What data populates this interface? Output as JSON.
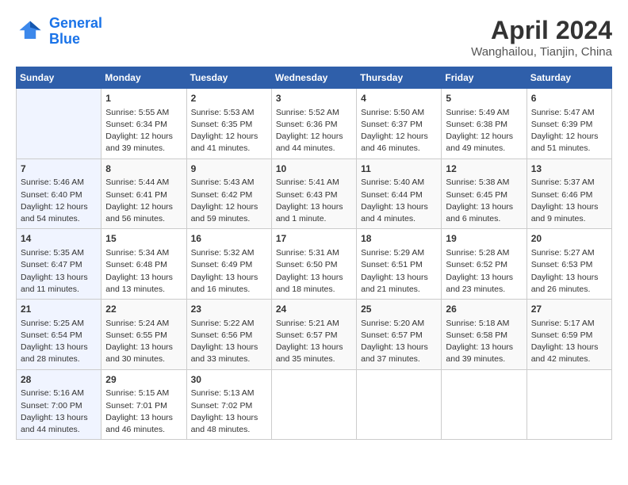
{
  "header": {
    "logo_line1": "General",
    "logo_line2": "Blue",
    "month": "April 2024",
    "location": "Wanghailou, Tianjin, China"
  },
  "days_of_week": [
    "Sunday",
    "Monday",
    "Tuesday",
    "Wednesday",
    "Thursday",
    "Friday",
    "Saturday"
  ],
  "weeks": [
    [
      {
        "num": "",
        "info": ""
      },
      {
        "num": "1",
        "info": "Sunrise: 5:55 AM\nSunset: 6:34 PM\nDaylight: 12 hours\nand 39 minutes."
      },
      {
        "num": "2",
        "info": "Sunrise: 5:53 AM\nSunset: 6:35 PM\nDaylight: 12 hours\nand 41 minutes."
      },
      {
        "num": "3",
        "info": "Sunrise: 5:52 AM\nSunset: 6:36 PM\nDaylight: 12 hours\nand 44 minutes."
      },
      {
        "num": "4",
        "info": "Sunrise: 5:50 AM\nSunset: 6:37 PM\nDaylight: 12 hours\nand 46 minutes."
      },
      {
        "num": "5",
        "info": "Sunrise: 5:49 AM\nSunset: 6:38 PM\nDaylight: 12 hours\nand 49 minutes."
      },
      {
        "num": "6",
        "info": "Sunrise: 5:47 AM\nSunset: 6:39 PM\nDaylight: 12 hours\nand 51 minutes."
      }
    ],
    [
      {
        "num": "7",
        "info": "Sunrise: 5:46 AM\nSunset: 6:40 PM\nDaylight: 12 hours\nand 54 minutes."
      },
      {
        "num": "8",
        "info": "Sunrise: 5:44 AM\nSunset: 6:41 PM\nDaylight: 12 hours\nand 56 minutes."
      },
      {
        "num": "9",
        "info": "Sunrise: 5:43 AM\nSunset: 6:42 PM\nDaylight: 12 hours\nand 59 minutes."
      },
      {
        "num": "10",
        "info": "Sunrise: 5:41 AM\nSunset: 6:43 PM\nDaylight: 13 hours\nand 1 minute."
      },
      {
        "num": "11",
        "info": "Sunrise: 5:40 AM\nSunset: 6:44 PM\nDaylight: 13 hours\nand 4 minutes."
      },
      {
        "num": "12",
        "info": "Sunrise: 5:38 AM\nSunset: 6:45 PM\nDaylight: 13 hours\nand 6 minutes."
      },
      {
        "num": "13",
        "info": "Sunrise: 5:37 AM\nSunset: 6:46 PM\nDaylight: 13 hours\nand 9 minutes."
      }
    ],
    [
      {
        "num": "14",
        "info": "Sunrise: 5:35 AM\nSunset: 6:47 PM\nDaylight: 13 hours\nand 11 minutes."
      },
      {
        "num": "15",
        "info": "Sunrise: 5:34 AM\nSunset: 6:48 PM\nDaylight: 13 hours\nand 13 minutes."
      },
      {
        "num": "16",
        "info": "Sunrise: 5:32 AM\nSunset: 6:49 PM\nDaylight: 13 hours\nand 16 minutes."
      },
      {
        "num": "17",
        "info": "Sunrise: 5:31 AM\nSunset: 6:50 PM\nDaylight: 13 hours\nand 18 minutes."
      },
      {
        "num": "18",
        "info": "Sunrise: 5:29 AM\nSunset: 6:51 PM\nDaylight: 13 hours\nand 21 minutes."
      },
      {
        "num": "19",
        "info": "Sunrise: 5:28 AM\nSunset: 6:52 PM\nDaylight: 13 hours\nand 23 minutes."
      },
      {
        "num": "20",
        "info": "Sunrise: 5:27 AM\nSunset: 6:53 PM\nDaylight: 13 hours\nand 26 minutes."
      }
    ],
    [
      {
        "num": "21",
        "info": "Sunrise: 5:25 AM\nSunset: 6:54 PM\nDaylight: 13 hours\nand 28 minutes."
      },
      {
        "num": "22",
        "info": "Sunrise: 5:24 AM\nSunset: 6:55 PM\nDaylight: 13 hours\nand 30 minutes."
      },
      {
        "num": "23",
        "info": "Sunrise: 5:22 AM\nSunset: 6:56 PM\nDaylight: 13 hours\nand 33 minutes."
      },
      {
        "num": "24",
        "info": "Sunrise: 5:21 AM\nSunset: 6:57 PM\nDaylight: 13 hours\nand 35 minutes."
      },
      {
        "num": "25",
        "info": "Sunrise: 5:20 AM\nSunset: 6:57 PM\nDaylight: 13 hours\nand 37 minutes."
      },
      {
        "num": "26",
        "info": "Sunrise: 5:18 AM\nSunset: 6:58 PM\nDaylight: 13 hours\nand 39 minutes."
      },
      {
        "num": "27",
        "info": "Sunrise: 5:17 AM\nSunset: 6:59 PM\nDaylight: 13 hours\nand 42 minutes."
      }
    ],
    [
      {
        "num": "28",
        "info": "Sunrise: 5:16 AM\nSunset: 7:00 PM\nDaylight: 13 hours\nand 44 minutes."
      },
      {
        "num": "29",
        "info": "Sunrise: 5:15 AM\nSunset: 7:01 PM\nDaylight: 13 hours\nand 46 minutes."
      },
      {
        "num": "30",
        "info": "Sunrise: 5:13 AM\nSunset: 7:02 PM\nDaylight: 13 hours\nand 48 minutes."
      },
      {
        "num": "",
        "info": ""
      },
      {
        "num": "",
        "info": ""
      },
      {
        "num": "",
        "info": ""
      },
      {
        "num": "",
        "info": ""
      }
    ]
  ]
}
